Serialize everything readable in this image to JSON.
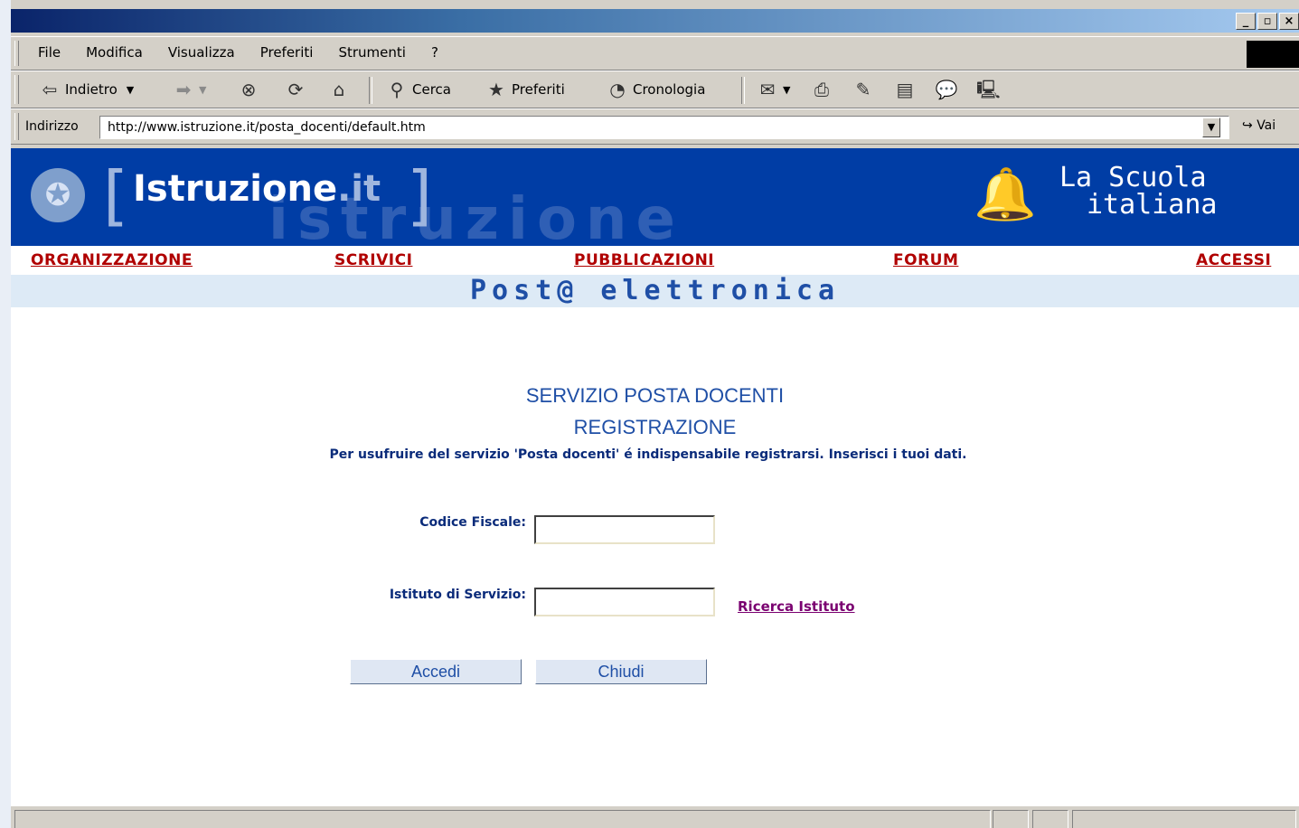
{
  "menu": [
    "File",
    "Modifica",
    "Visualizza",
    "Preferiti",
    "Strumenti",
    "?"
  ],
  "toolbar": {
    "back": "Indietro",
    "search": "Cerca",
    "favorites": "Preferiti",
    "history": "Cronologia"
  },
  "address": {
    "label": "Indirizzo",
    "url": "http://www.istruzione.it/posta_docenti/default.htm",
    "go": "Vai"
  },
  "banner": {
    "logo_main": "Istruzione",
    "logo_suffix": ".it",
    "ghost_word": "istruzione",
    "brand_line1": "La Scuola",
    "brand_line2": "italiana"
  },
  "nav": [
    "ORGANIZZAZIONE",
    "SCRIVICI",
    "PUBBLICAZIONI",
    "FORUM",
    "ACCESSI"
  ],
  "section_title": "Post@ elettronica",
  "form": {
    "title": "SERVIZIO POSTA DOCENTI",
    "subtitle": "REGISTRAZIONE",
    "intro": "Per usufruire del servizio 'Posta docenti' é indispensabile registrarsi. Inserisci i tuoi dati.",
    "codice_label": "Codice Fiscale:",
    "codice_value": "",
    "istituto_label": "Istituto di Servizio:",
    "istituto_value": "",
    "search_link": "Ricerca Istituto",
    "submit": "Accedi",
    "close": "Chiudi"
  },
  "colors": {
    "banner": "#003da5",
    "nav_link": "#b00000",
    "heading": "#1f4fa6"
  }
}
